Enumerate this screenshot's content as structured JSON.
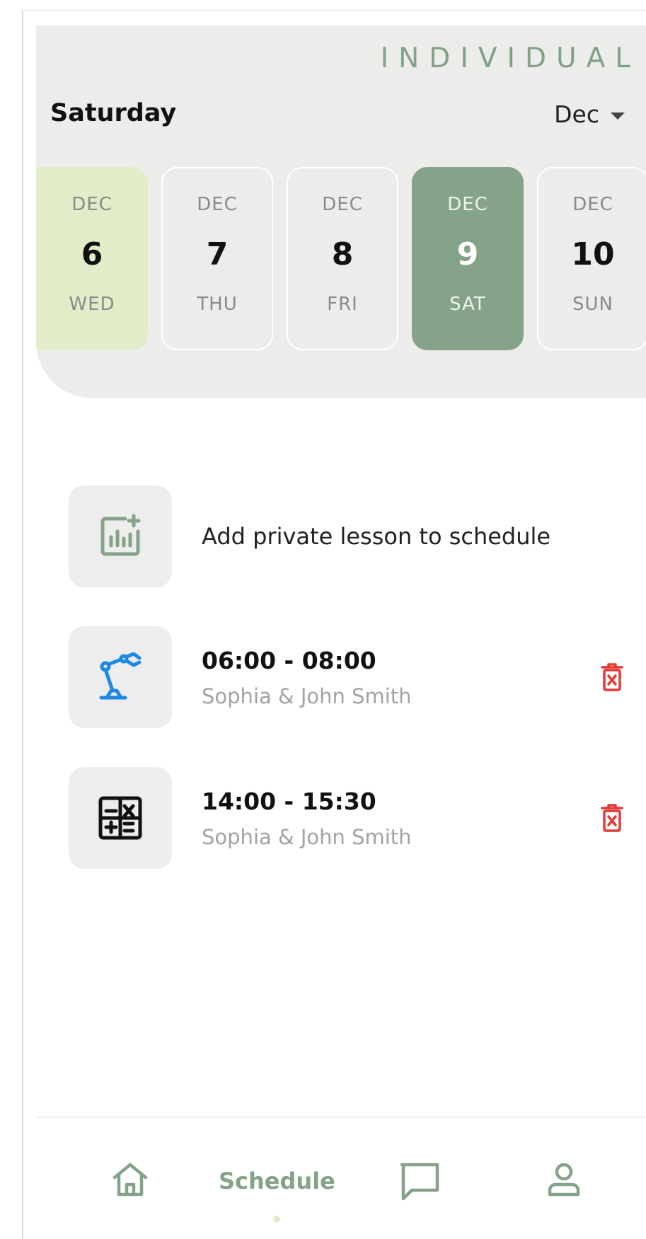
{
  "brand": "INDIVIDUAL",
  "header": {
    "day_name": "Saturday",
    "month_selected": "Dec"
  },
  "days": [
    {
      "month": "DEC",
      "day": "6",
      "weekday": "WED",
      "state": "today"
    },
    {
      "month": "DEC",
      "day": "7",
      "weekday": "THU",
      "state": "normal"
    },
    {
      "month": "DEC",
      "day": "8",
      "weekday": "FRI",
      "state": "normal"
    },
    {
      "month": "DEC",
      "day": "9",
      "weekday": "SAT",
      "state": "selected"
    },
    {
      "month": "DEC",
      "day": "10",
      "weekday": "SUN",
      "state": "normal"
    }
  ],
  "add_lesson": {
    "label": "Add private lesson to schedule",
    "icon": "add-chart-icon"
  },
  "lessons": [
    {
      "time": "06:00 - 08:00",
      "people": "Sophia & John Smith",
      "icon": "robot-arm-icon"
    },
    {
      "time": "14:00 - 15:30",
      "people": "Sophia & John Smith",
      "icon": "calculator-icon"
    }
  ],
  "nav": {
    "home_icon": "home-icon",
    "schedule_label": "Schedule",
    "chat_icon": "chat-icon",
    "profile_icon": "profile-icon"
  },
  "colors": {
    "accent": "#85a389",
    "today_bg": "#e1ecc9",
    "header_bg": "#ececea",
    "delete": "#e53935",
    "robot_blue": "#1e88e5"
  }
}
